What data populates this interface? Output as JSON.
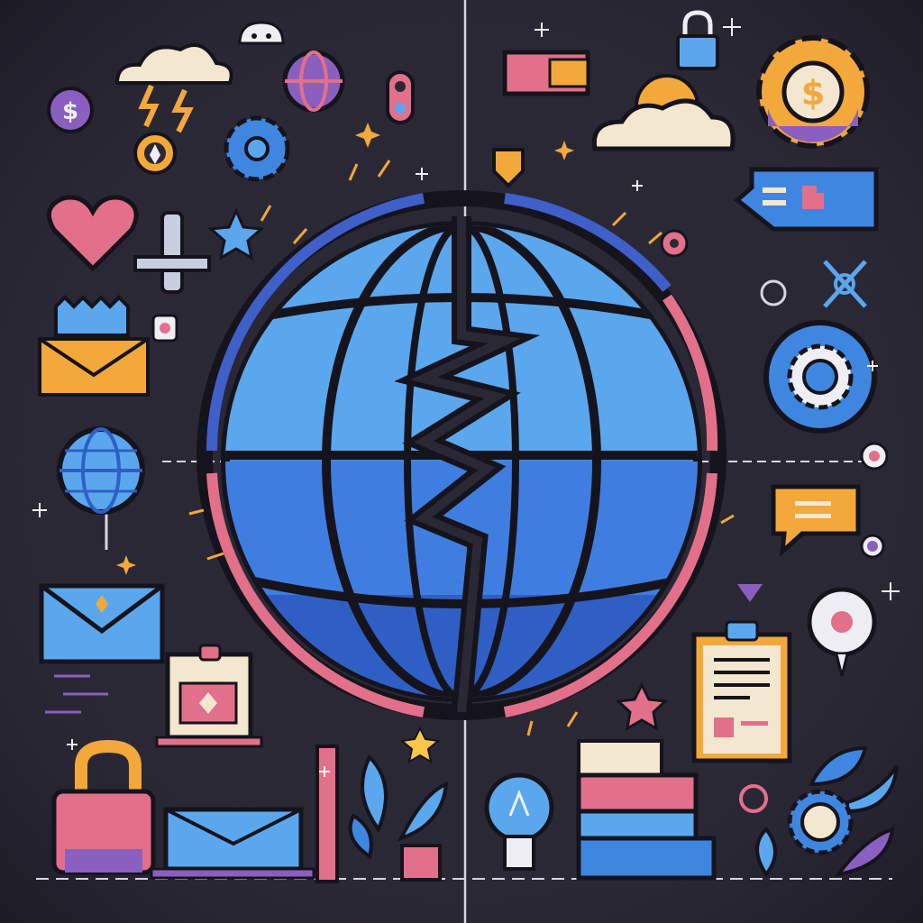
{
  "colors": {
    "background": "#2b2836",
    "background_dark": "#221f2c",
    "globe_blue": "#3f86e0",
    "globe_light": "#5aa7ee",
    "globe_dark": "#2f5fc4",
    "ring_pink": "#e2708a",
    "accent_purple": "#8a5fc0",
    "accent_orange": "#f2a83a",
    "accent_yellow": "#f7c64a",
    "outline": "#15131c",
    "cream": "#f4e7cf",
    "white": "#f0eef5"
  },
  "icons": [
    "split-globe-icon",
    "dollar-coin-icon",
    "cloud-lightning-icon",
    "ghost-cloud-icon",
    "globe-ball-icon",
    "traffic-light-icon",
    "location-pin-icon",
    "gear-icon",
    "heart-icon",
    "airplane-icon",
    "star-icon",
    "crown-mail-icon",
    "globe-pin-icon",
    "envelope-icon",
    "id-badge-icon",
    "padlock-icon",
    "laptop-mail-icon",
    "pencil-icon",
    "plant-icon",
    "lock-icon",
    "wallet-icon",
    "sun-cloud-icon",
    "dollar-gear-icon",
    "chat-bubble-puzzle-icon",
    "target-icon",
    "gear-badge-icon",
    "chat-bubble-icon",
    "clipboard-icon",
    "printer-icon",
    "lightbulb-icon",
    "gear-plant-icon"
  ]
}
